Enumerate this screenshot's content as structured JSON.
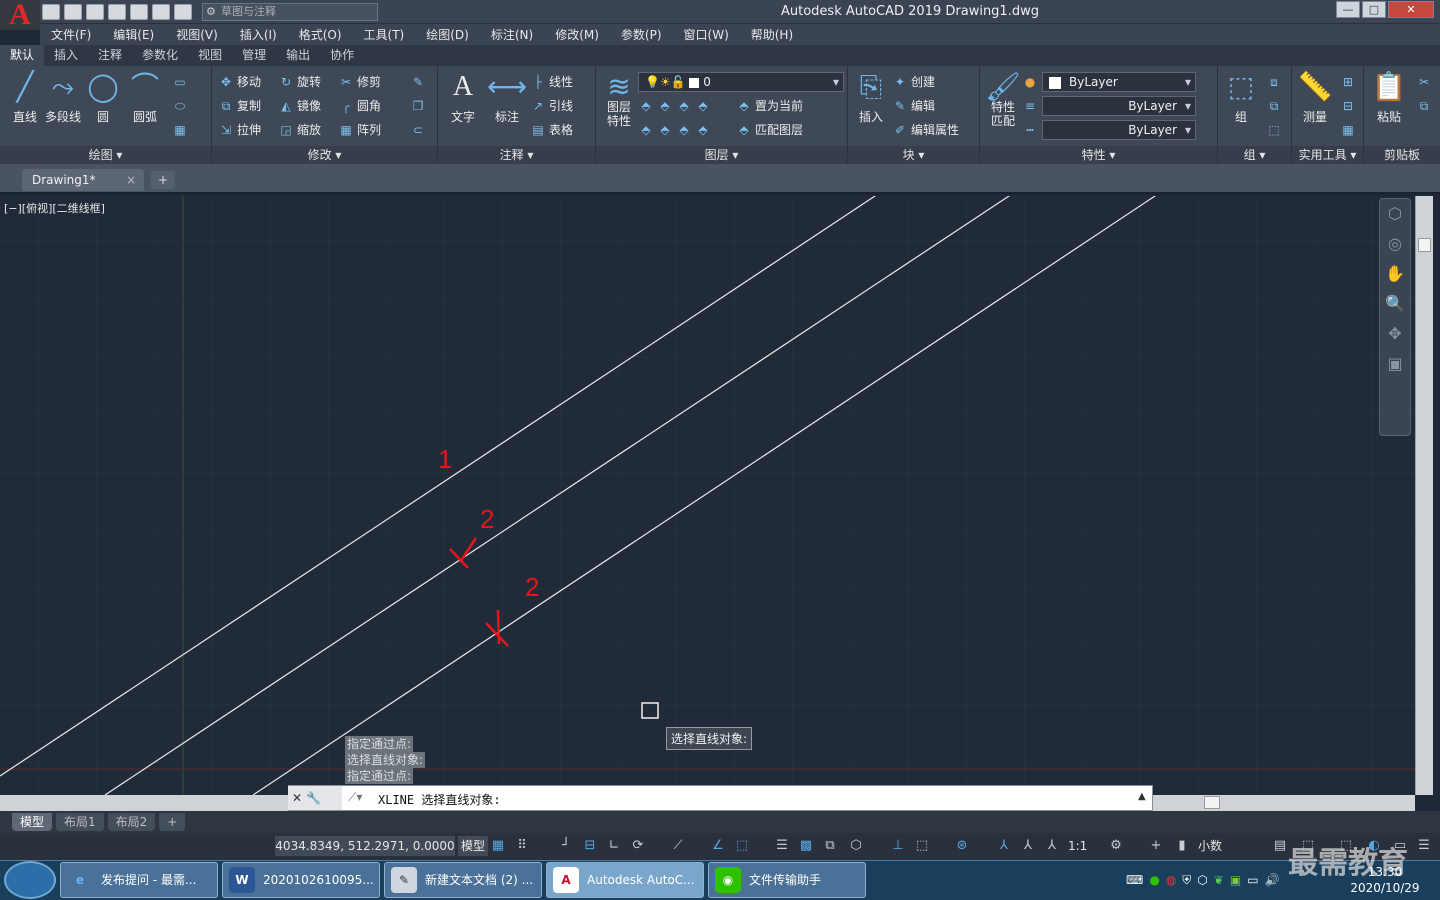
{
  "title_bar": {
    "app_title": "Autodesk AutoCAD 2019    Drawing1.dwg",
    "logo": "A",
    "workspace": "草图与注释"
  },
  "menu": [
    "文件(F)",
    "编辑(E)",
    "视图(V)",
    "插入(I)",
    "格式(O)",
    "工具(T)",
    "绘图(D)",
    "标注(N)",
    "修改(M)",
    "参数(P)",
    "窗口(W)",
    "帮助(H)"
  ],
  "ribbon_tabs": [
    "默认",
    "插入",
    "注释",
    "参数化",
    "视图",
    "管理",
    "输出",
    "协作"
  ],
  "draw_panel": {
    "line": "直线",
    "polyline": "多段线",
    "circle": "圆",
    "arc": "圆弧",
    "title": "绘图 ▾"
  },
  "modify_panel": {
    "move": "移动",
    "rotate": "旋转",
    "trim": "修剪",
    "copy": "复制",
    "mirror": "镜像",
    "fillet": "圆角",
    "stretch": "拉伸",
    "scale": "缩放",
    "array": "阵列",
    "title": "修改 ▾"
  },
  "annotation_panel": {
    "text": "文字",
    "dimension": "标注",
    "linear": "线性",
    "leader": "引线",
    "table": "表格",
    "title": "注释 ▾"
  },
  "layers_panel": {
    "layer_properties": "图层\n特性",
    "current_layer": "0",
    "make_current": "置为当前",
    "match_layer": "匹配图层",
    "title": "图层 ▾"
  },
  "block_panel": {
    "insert": "插入",
    "create": "创建",
    "edit": "编辑",
    "edit_attributes": "编辑属性",
    "title": "块 ▾"
  },
  "properties_panel": {
    "match": "特性\n匹配",
    "color": "ByLayer",
    "linetype": "ByLayer",
    "lineweight": "ByLayer",
    "title": "特性 ▾"
  },
  "group_panel": {
    "group": "组",
    "title": "组 ▾"
  },
  "utilities_panel": {
    "measure": "测量",
    "title": "实用工具 ▾"
  },
  "clipboard_panel": {
    "paste": "粘贴",
    "title": "剪贴板"
  },
  "doc_tab": {
    "name": "Drawing1*",
    "close": "×",
    "new": "+"
  },
  "viewport": {
    "label": "[−][俯视][二维线框]"
  },
  "annotations": {
    "label1": "1",
    "label2a": "2",
    "label2b": "2"
  },
  "command_history": [
    "指定通过点:",
    "选择直线对象:",
    "指定通过点:"
  ],
  "tooltip": "选择直线对象:",
  "command_line": {
    "text": "XLINE 选择直线对象:"
  },
  "layout_tabs": [
    "模型",
    "布局1",
    "布局2",
    "+"
  ],
  "status": {
    "coords": "4034.8349, 512.2971, 0.0000",
    "model": "模型",
    "scale": "1:1",
    "units": "小数"
  },
  "taskbar": {
    "tasks": [
      "发布提问 - 最需...",
      "2020102610095...",
      "新建文本文档 (2) ...",
      "Autodesk AutoC...",
      "文件传输助手"
    ],
    "time": "13:30",
    "date": "2020/10/29"
  },
  "watermark": "最需教育",
  "colors": {
    "canvas": "#212a38",
    "accent_red": "#e8141c",
    "ribbon": "#3f4856"
  }
}
